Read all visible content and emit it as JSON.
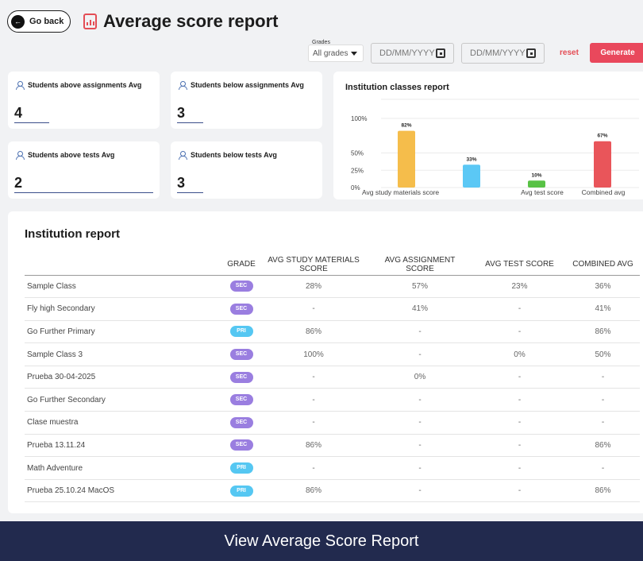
{
  "header": {
    "back_label": "Go back",
    "title": "Average score report"
  },
  "filters": {
    "grades_label": "Grades",
    "grades_selected": "All grades",
    "date_from_placeholder": "DD/MM/YYYY",
    "date_to_placeholder": "DD/MM/YYYY",
    "reset_label": "reset",
    "generate_label": "Generate"
  },
  "stats": {
    "above_assign": {
      "label": "Students above assignments Avg",
      "value": "4"
    },
    "below_assign": {
      "label": "Students below assignments Avg",
      "value": "3"
    },
    "above_tests": {
      "label": "Students above tests Avg",
      "value": "2"
    },
    "below_tests": {
      "label": "Students below tests Avg",
      "value": "3"
    }
  },
  "chart_data": {
    "type": "bar",
    "title": "Institution classes report",
    "categories": [
      "Avg study materials score",
      "",
      "Avg test score",
      "Combined avg"
    ],
    "values": [
      82,
      33,
      10,
      67
    ],
    "value_labels": [
      "82%",
      "33%",
      "10%",
      "67%"
    ],
    "colors": [
      "#f5bd4b",
      "#5bc8f5",
      "#58c245",
      "#e9555a"
    ],
    "y_ticks": [
      "0%",
      "25%",
      "50%",
      "100%"
    ],
    "ylim": [
      0,
      100
    ],
    "grid": true
  },
  "institution": {
    "title": "Institution report",
    "columns": [
      "",
      "GRADE",
      "AVG STUDY MATERIALS SCORE",
      "AVG ASSIGNMENT SCORE",
      "AVG TEST SCORE",
      "COMBINED AVG"
    ],
    "badge_colors": {
      "SEC": "#9a7ee0",
      "PRI": "#55c7f2"
    },
    "rows": [
      {
        "name": "Sample Class",
        "grade": "SEC",
        "study": "28%",
        "assign": "57%",
        "test": "23%",
        "combined": "36%"
      },
      {
        "name": "Fly high Secondary",
        "grade": "SEC",
        "study": "-",
        "assign": "41%",
        "test": "-",
        "combined": "41%"
      },
      {
        "name": "Go Further Primary",
        "grade": "PRI",
        "study": "86%",
        "assign": "-",
        "test": "-",
        "combined": "86%"
      },
      {
        "name": "Sample Class 3",
        "grade": "SEC",
        "study": "100%",
        "assign": "-",
        "test": "0%",
        "combined": "50%"
      },
      {
        "name": "Prueba 30-04-2025",
        "grade": "SEC",
        "study": "-",
        "assign": "0%",
        "test": "-",
        "combined": "-"
      },
      {
        "name": "Go Further Secondary",
        "grade": "SEC",
        "study": "-",
        "assign": "-",
        "test": "-",
        "combined": "-"
      },
      {
        "name": "Clase muestra",
        "grade": "SEC",
        "study": "-",
        "assign": "-",
        "test": "-",
        "combined": "-"
      },
      {
        "name": "Prueba 13.11.24",
        "grade": "SEC",
        "study": "86%",
        "assign": "-",
        "test": "-",
        "combined": "86%"
      },
      {
        "name": "Math Adventure",
        "grade": "PRI",
        "study": "-",
        "assign": "-",
        "test": "-",
        "combined": "-"
      },
      {
        "name": "Prueba 25.10.24 MacOS",
        "grade": "PRI",
        "study": "86%",
        "assign": "-",
        "test": "-",
        "combined": "86%"
      }
    ]
  },
  "footer": {
    "label": "View Average Score Report"
  }
}
